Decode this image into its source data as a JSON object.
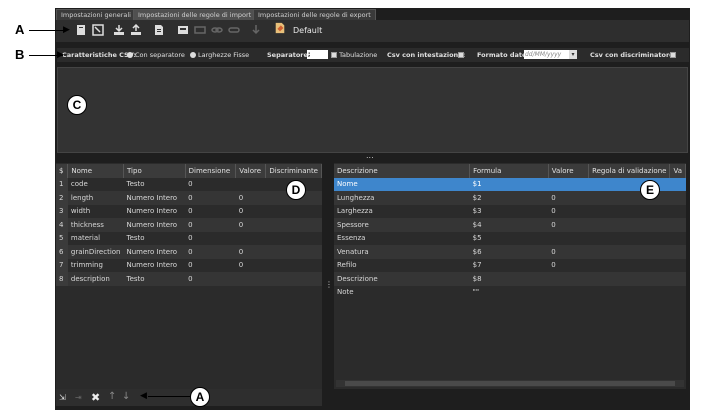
{
  "tabs": [
    {
      "label": "Impostazioni generali",
      "active": false
    },
    {
      "label": "Impostazioni delle regole di import",
      "active": true
    },
    {
      "label": "Impostazioni delle regole di export",
      "active": false
    }
  ],
  "toolbar": {
    "default_label": "Default",
    "icons": [
      "new-icon",
      "open-icon",
      "import-icon",
      "export-icon",
      "document-icon",
      "save-icon",
      "link-icon",
      "chain-icon",
      "link-alt-icon",
      "down-arrow-icon"
    ]
  },
  "settings": {
    "characteristics_label": "Caratteristiche CSV:",
    "with_separator": "Con separatore",
    "fixed_widths": "Larghezze Fisse",
    "separator_label": "Separatore:",
    "separator_value": ";",
    "tab_label": "Tabulazione",
    "header_label": "Csv con intestazione:",
    "date_format_label": "Formato date:",
    "date_format_value": "dd/MM/yyyy",
    "discriminator_label": "Csv con discriminatore:"
  },
  "splitter_dots": "...",
  "left_table": {
    "headers": [
      "$",
      "Nome",
      "Tipo",
      "Dimensione",
      "Valore",
      "Discriminante"
    ],
    "rows": [
      {
        "n": "1",
        "name": "code",
        "type": "Testo",
        "dim": "0",
        "val": ""
      },
      {
        "n": "2",
        "name": "length",
        "type": "Numero Intero",
        "dim": "0",
        "val": "0"
      },
      {
        "n": "3",
        "name": "width",
        "type": "Numero Intero",
        "dim": "0",
        "val": "0"
      },
      {
        "n": "4",
        "name": "thickness",
        "type": "Numero Intero",
        "dim": "0",
        "val": "0"
      },
      {
        "n": "5",
        "name": "material",
        "type": "Testo",
        "dim": "0",
        "val": ""
      },
      {
        "n": "6",
        "name": "grainDirection",
        "type": "Numero Intero",
        "dim": "0",
        "val": "0"
      },
      {
        "n": "7",
        "name": "trimming",
        "type": "Numero Intero",
        "dim": "0",
        "val": "0"
      },
      {
        "n": "8",
        "name": "description",
        "type": "Testo",
        "dim": "0",
        "val": ""
      }
    ]
  },
  "right_table": {
    "headers": [
      "Descrizione",
      "Formula",
      "Valore",
      "Regola di validazione",
      "Va"
    ],
    "rows": [
      {
        "desc": "Nome",
        "formula": "$1",
        "val": ""
      },
      {
        "desc": "Lunghezza",
        "formula": "$2",
        "val": "0"
      },
      {
        "desc": "Larghezza",
        "formula": "$3",
        "val": "0"
      },
      {
        "desc": "Spessore",
        "formula": "$4",
        "val": "0"
      },
      {
        "desc": "Essenza",
        "formula": "$5",
        "val": ""
      },
      {
        "desc": "Venatura",
        "formula": "$6",
        "val": "0"
      },
      {
        "desc": "Refilo",
        "formula": "$7",
        "val": "0"
      },
      {
        "desc": "Descrizione",
        "formula": "$8",
        "val": ""
      },
      {
        "desc": "Note",
        "formula": "\"\"",
        "val": ""
      }
    ]
  },
  "callouts": {
    "a_top": "A",
    "b": "B",
    "c": "C",
    "d": "D",
    "e": "E",
    "a_bottom": "A"
  }
}
